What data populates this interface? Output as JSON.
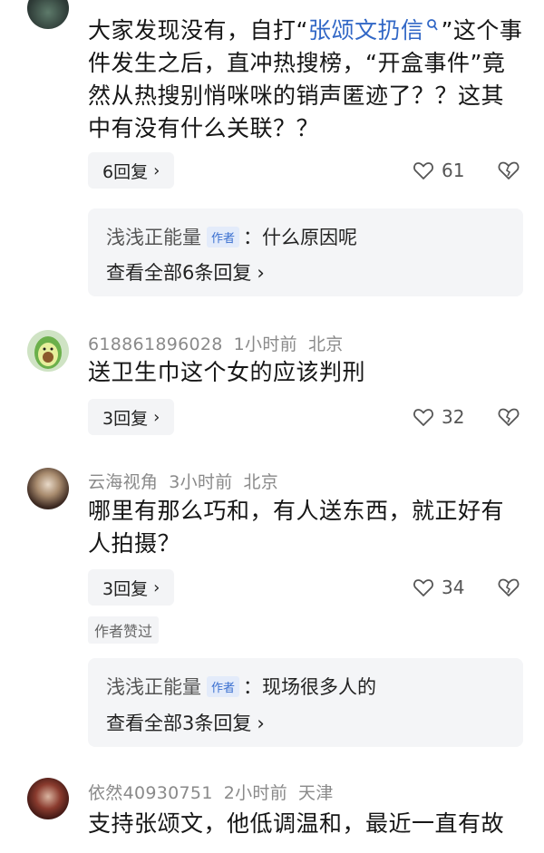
{
  "comments": [
    {
      "text_parts": [
        "大家发现没有，自打“",
        "张颂文扔信",
        "”这个事件发生之后，直冲热搜榜，“开盒事件”竟然从热搜别悄咪咪的销声匿迹了？？这其中有没有什么关联？？"
      ],
      "reply_label": "6回复",
      "likes": "61",
      "sub_reply": {
        "name": "浅浅正能量",
        "badge": "作者",
        "text": "：什么原因呢",
        "view_all": "查看全部6条回复"
      }
    },
    {
      "username": "618861896028",
      "time": "1小时前",
      "location": "北京",
      "text": "送卫生巾这个女的应该判刑",
      "reply_label": "3回复",
      "likes": "32"
    },
    {
      "username": "云海视角",
      "time": "3小时前",
      "location": "北京",
      "text": "哪里有那么巧和，有人送东西，就正好有人拍摄？",
      "reply_label": "3回复",
      "likes": "34",
      "author_liked": "作者赞过",
      "sub_reply": {
        "name": "浅浅正能量",
        "badge": "作者",
        "text": "：现场很多人的",
        "view_all": "查看全部3条回复"
      }
    },
    {
      "username": "依然40930751",
      "time": "2小时前",
      "location": "天津",
      "text": "支持张颂文，他低调温和，最近一直有故"
    }
  ],
  "icons": {
    "like": "heart-outline-icon",
    "dislike": "broken-heart-icon",
    "chevron": "chevron-right-icon",
    "search": "search-icon"
  },
  "colors": {
    "link": "#3167c6",
    "meta": "#8a8a8a",
    "badge": "#3a6fd0"
  }
}
